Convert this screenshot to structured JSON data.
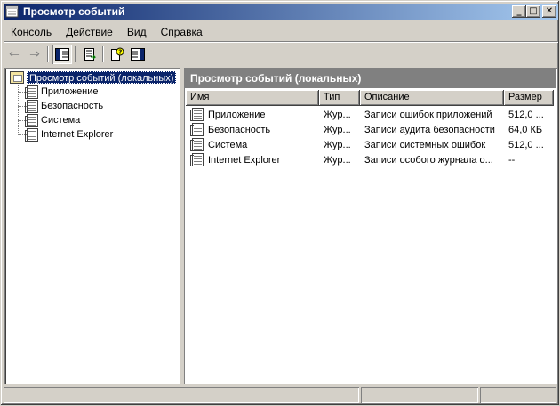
{
  "window": {
    "title": "Просмотр событий"
  },
  "title_buttons": {
    "minimize": "_",
    "maximize": "□",
    "close": "✕"
  },
  "menu": [
    {
      "label": "Консоль"
    },
    {
      "label": "Действие"
    },
    {
      "label": "Вид"
    },
    {
      "label": "Справка"
    }
  ],
  "toolbar": {
    "icons": [
      "back-arrow-icon",
      "forward-arrow-icon",
      "show-hide-tree-icon",
      "export-list-icon",
      "help-icon",
      "properties-icon"
    ],
    "back": "⇐",
    "forward": "⇒"
  },
  "tree": {
    "root": "Просмотр событий (локальных)",
    "items": [
      "Приложение",
      "Безопасность",
      "Система",
      "Internet Explorer"
    ]
  },
  "right_pane": {
    "header": "Просмотр событий (локальных)",
    "columns": [
      "Имя",
      "Тип",
      "Описание",
      "Размер"
    ],
    "rows": [
      {
        "name": "Приложение",
        "type": "Жур...",
        "description": "Записи ошибок приложений",
        "size": "512,0 ..."
      },
      {
        "name": "Безопасность",
        "type": "Жур...",
        "description": "Записи аудита безопасности",
        "size": "64,0 КБ"
      },
      {
        "name": "Система",
        "type": "Жур...",
        "description": "Записи системных ошибок",
        "size": "512,0 ..."
      },
      {
        "name": "Internet Explorer",
        "type": "Жур...",
        "description": "Записи особого журнала о...",
        "size": "--"
      }
    ]
  },
  "colors": {
    "title_start": "#0a246a",
    "title_end": "#a6caf0",
    "face": "#d4d0c8",
    "pane_header": "#808080"
  }
}
